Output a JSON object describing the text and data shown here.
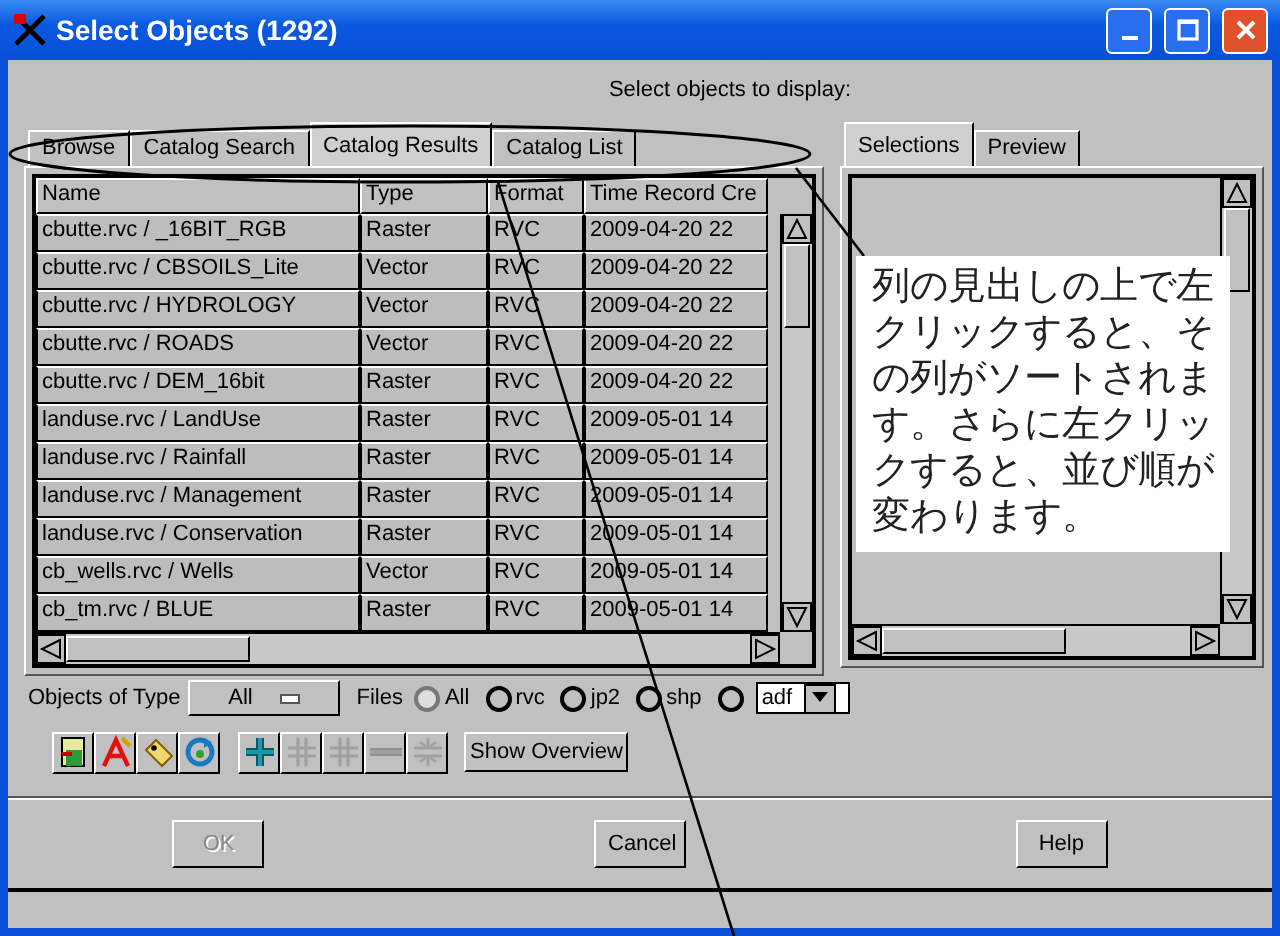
{
  "window": {
    "title": "Select Objects (1292)"
  },
  "prompt": "Select objects to display:",
  "tabs": [
    {
      "label": "Browse",
      "selected": false
    },
    {
      "label": "Catalog Search",
      "selected": false
    },
    {
      "label": "Catalog Results",
      "selected": true
    },
    {
      "label": "Catalog List",
      "selected": false
    }
  ],
  "table": {
    "columns": [
      "Name",
      "Type",
      "Format",
      "Time Record Cre"
    ],
    "rows": [
      [
        "cbutte.rvc / _16BIT_RGB",
        "Raster",
        "RVC",
        "2009-04-20 22"
      ],
      [
        "cbutte.rvc / CBSOILS_Lite",
        "Vector",
        "RVC",
        "2009-04-20 22"
      ],
      [
        "cbutte.rvc / HYDROLOGY",
        "Vector",
        "RVC",
        "2009-04-20 22"
      ],
      [
        "cbutte.rvc / ROADS",
        "Vector",
        "RVC",
        "2009-04-20 22"
      ],
      [
        "cbutte.rvc / DEM_16bit",
        "Raster",
        "RVC",
        "2009-04-20 22"
      ],
      [
        "landuse.rvc / LandUse",
        "Raster",
        "RVC",
        "2009-05-01 14"
      ],
      [
        "landuse.rvc / Rainfall",
        "Raster",
        "RVC",
        "2009-05-01 14"
      ],
      [
        "landuse.rvc / Management",
        "Raster",
        "RVC",
        "2009-05-01 14"
      ],
      [
        "landuse.rvc / Conservation",
        "Raster",
        "RVC",
        "2009-05-01 14"
      ],
      [
        "cb_wells.rvc / Wells",
        "Vector",
        "RVC",
        "2009-05-01 14"
      ],
      [
        "cb_tm.rvc / BLUE",
        "Raster",
        "RVC",
        "2009-05-01 14"
      ]
    ]
  },
  "side_tabs": [
    {
      "label": "Selections",
      "selected": true
    },
    {
      "label": "Preview",
      "selected": false
    }
  ],
  "filter": {
    "label": "Objects of Type",
    "value": "All",
    "files_label": "Files",
    "files": [
      {
        "label": "All",
        "selected": true
      },
      {
        "label": "rvc",
        "selected": false
      },
      {
        "label": "jp2",
        "selected": false
      },
      {
        "label": "shp",
        "selected": false
      },
      {
        "selected": false
      }
    ],
    "extension": "adf"
  },
  "tools": [
    {
      "kind": "add-object",
      "disabled": false
    },
    {
      "kind": "text",
      "disabled": false
    },
    {
      "kind": "tag",
      "disabled": false
    },
    {
      "kind": "refresh",
      "disabled": false
    },
    {
      "kind": "plus",
      "disabled": false
    },
    {
      "kind": "plus-grid",
      "disabled": true
    },
    {
      "kind": "plus-grid",
      "disabled": true
    },
    {
      "kind": "minus",
      "disabled": true
    },
    {
      "kind": "minus-grid",
      "disabled": true
    }
  ],
  "overview_button": "Show Overview",
  "buttons": [
    {
      "label": "OK",
      "disabled": true
    },
    {
      "label": "Cancel",
      "disabled": false
    },
    {
      "label": "Help",
      "disabled": false
    }
  ],
  "callout": "列の見出しの上で左クリックすると、その列がソートされます。さらに左クリックすると、並び順が変わります。"
}
